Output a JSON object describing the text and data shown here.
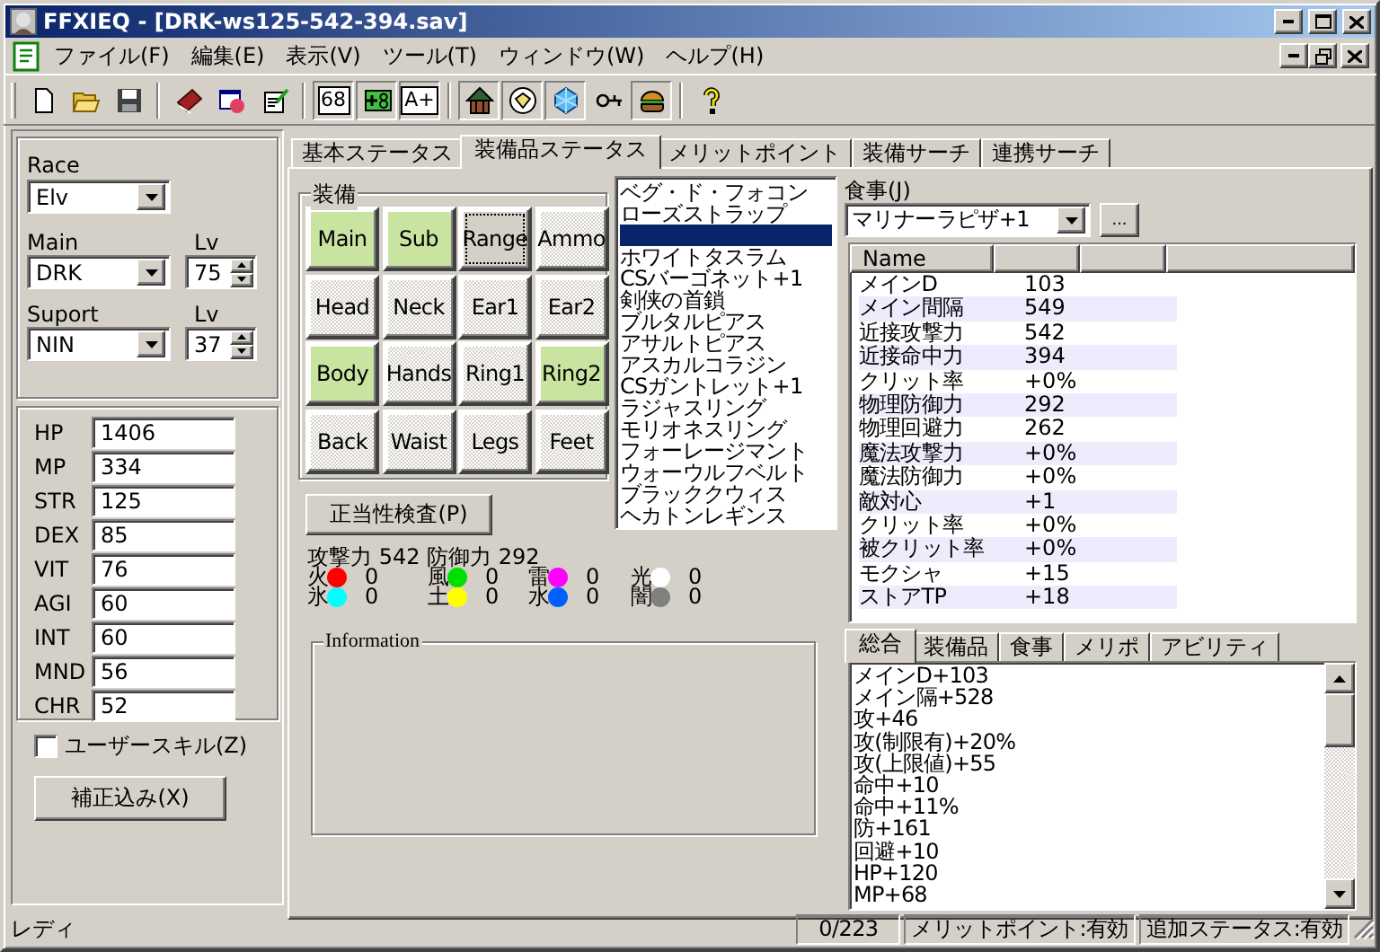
{
  "window": {
    "title": "FFXIEQ - [DRK-ws125-542-394.sav]"
  },
  "menu": [
    "ファイル(F)",
    "編集(E)",
    "表示(V)",
    "ツール(T)",
    "ウィンドウ(W)",
    "ヘルプ(H)"
  ],
  "toolbar": [
    {
      "kind": "icon",
      "pressed": false
    },
    {
      "kind": "icon",
      "pressed": false
    },
    {
      "kind": "icon",
      "pressed": false
    },
    {
      "kind": "separator"
    },
    {
      "kind": "icon",
      "pressed": false
    },
    {
      "kind": "icon",
      "pressed": false
    },
    {
      "kind": "icon",
      "pressed": false
    },
    {
      "kind": "separator"
    },
    {
      "kind": "text",
      "label": "68",
      "pressed": true
    },
    {
      "kind": "icon",
      "pressed": true
    },
    {
      "kind": "text",
      "label": "A+",
      "pressed": true
    },
    {
      "kind": "separator"
    },
    {
      "kind": "icon",
      "pressed": true
    },
    {
      "kind": "icon",
      "pressed": true
    },
    {
      "kind": "icon",
      "pressed": true
    },
    {
      "kind": "icon",
      "pressed": false
    },
    {
      "kind": "icon",
      "pressed": true
    },
    {
      "kind": "separator"
    },
    {
      "kind": "icon",
      "pressed": false
    }
  ],
  "character": {
    "race_label": "Race",
    "race": "Elv",
    "main_label": "Main",
    "main_job": "DRK",
    "main_lv_label": "Lv",
    "main_lv": "75",
    "support_label": "Suport",
    "support_job": "NIN",
    "support_lv_label": "Lv",
    "support_lv": "37"
  },
  "stats": [
    {
      "name": "HP",
      "value": "1406"
    },
    {
      "name": "MP",
      "value": "334"
    },
    {
      "name": "STR",
      "value": "125"
    },
    {
      "name": "DEX",
      "value": "85"
    },
    {
      "name": "VIT",
      "value": "76"
    },
    {
      "name": "AGI",
      "value": "60"
    },
    {
      "name": "INT",
      "value": "60"
    },
    {
      "name": "MND",
      "value": "56"
    },
    {
      "name": "CHR",
      "value": "52"
    }
  ],
  "user_skill": {
    "label": "ユーザースキル(Z)",
    "checked": false
  },
  "adjust_button": "補正込み(X)",
  "tabs": [
    {
      "label": "基本ステータス",
      "selected": false
    },
    {
      "label": "装備品ステータス",
      "selected": true
    },
    {
      "label": "メリットポイント",
      "selected": false
    },
    {
      "label": "装備サーチ",
      "selected": false
    },
    {
      "label": "連携サーチ",
      "selected": false
    }
  ],
  "equipment": {
    "title": "装備",
    "slots": [
      {
        "label": "Main",
        "equipped": true,
        "focused": false
      },
      {
        "label": "Sub",
        "equipped": true,
        "focused": false
      },
      {
        "label": "Range",
        "equipped": false,
        "focused": true
      },
      {
        "label": "Ammo",
        "equipped": false,
        "focused": false
      },
      {
        "label": "Head",
        "equipped": false,
        "focused": false
      },
      {
        "label": "Neck",
        "equipped": false,
        "focused": false
      },
      {
        "label": "Ear1",
        "equipped": false,
        "focused": false
      },
      {
        "label": "Ear2",
        "equipped": false,
        "focused": false
      },
      {
        "label": "Body",
        "equipped": true,
        "focused": false
      },
      {
        "label": "Hands",
        "equipped": false,
        "focused": false
      },
      {
        "label": "Ring1",
        "equipped": false,
        "focused": false
      },
      {
        "label": "Ring2",
        "equipped": true,
        "focused": false
      },
      {
        "label": "Back",
        "equipped": false,
        "focused": false
      },
      {
        "label": "Waist",
        "equipped": false,
        "focused": false
      },
      {
        "label": "Legs",
        "equipped": false,
        "focused": false
      },
      {
        "label": "Feet",
        "equipped": false,
        "focused": false
      }
    ]
  },
  "items": [
    {
      "text": "ベグ・ド・フォコン",
      "selected": false
    },
    {
      "text": "ローズストラップ",
      "selected": false
    },
    {
      "selected": true
    },
    {
      "text": "ホワイトタスラム",
      "selected": false
    },
    {
      "text": "CSバーゴネット+1",
      "selected": false
    },
    {
      "text": "剣侠の首鎖",
      "selected": false
    },
    {
      "text": "ブルタルピアス",
      "selected": false
    },
    {
      "text": "アサルトピアス",
      "selected": false
    },
    {
      "text": "アスカルコラジン",
      "selected": false
    },
    {
      "text": "CSガントレット+1",
      "selected": false
    },
    {
      "text": "ラジャスリング",
      "selected": false
    },
    {
      "text": "モリオネスリング",
      "selected": false
    },
    {
      "text": "フォーレージマント",
      "selected": false
    },
    {
      "text": "ウォーウルフベルト",
      "selected": false
    },
    {
      "text": "ブラッククウィス",
      "selected": false
    },
    {
      "text": "ヘカトンレギンス",
      "selected": false
    }
  ],
  "validate_button": "正当性検査(P)",
  "attack_defense": "攻撃力 542 防御力 292",
  "elements": [
    {
      "name": "火",
      "color": "#ff0000",
      "value": "0"
    },
    {
      "name": "風",
      "color": "#00e000",
      "value": "0"
    },
    {
      "name": "雷",
      "color": "#ff00ff",
      "value": "0"
    },
    {
      "name": "光",
      "color": "#ffffff",
      "value": "0"
    },
    {
      "name": "氷",
      "color": "#00ffff",
      "value": "0"
    },
    {
      "name": "土",
      "color": "#ffff00",
      "value": "0"
    },
    {
      "name": "水",
      "color": "#0060ff",
      "value": "0"
    },
    {
      "name": "闇",
      "color": "#808080",
      "value": "0"
    }
  ],
  "information": {
    "title": "Information"
  },
  "food": {
    "label": "食事(J)",
    "value": "マリナーラピザ+1",
    "more_button": "..."
  },
  "table": {
    "columns": [
      "Name"
    ],
    "rows": [
      {
        "name": "メインD",
        "value": "103"
      },
      {
        "name": "メイン間隔",
        "value": "549"
      },
      {
        "name": "近接攻撃力",
        "value": "542"
      },
      {
        "name": "近接命中力",
        "value": "394"
      },
      {
        "name": "クリット率",
        "value": "+0%"
      },
      {
        "name": "物理防御力",
        "value": "292"
      },
      {
        "name": "物理回避力",
        "value": "262"
      },
      {
        "name": "魔法攻撃力",
        "value": "+0%"
      },
      {
        "name": "魔法防御力",
        "value": "+0%"
      },
      {
        "name": "敵対心",
        "value": "+1"
      },
      {
        "name": "クリット率",
        "value": "+0%"
      },
      {
        "name": "被クリット率",
        "value": "+0%"
      },
      {
        "name": "モクシャ",
        "value": "+15"
      },
      {
        "name": "ストアTP",
        "value": "+18"
      }
    ]
  },
  "summary_tabs": [
    {
      "label": "総合",
      "selected": true
    },
    {
      "label": "装備品",
      "selected": false
    },
    {
      "label": "食事",
      "selected": false
    },
    {
      "label": "メリポ",
      "selected": false
    },
    {
      "label": "アビリティ",
      "selected": false
    }
  ],
  "summary_list": [
    "メインD+103",
    "メイン隔+528",
    "攻+46",
    "攻(制限有)+20%",
    "攻(上限値)+55",
    "命中+10",
    "命中+11%",
    "防+161",
    "回避+10",
    "HP+120",
    "MP+68"
  ],
  "status_bar": {
    "message": "レディ",
    "count": "0/223",
    "merit": "メリットポイント:有効",
    "extra": "追加ステータス:有効"
  }
}
